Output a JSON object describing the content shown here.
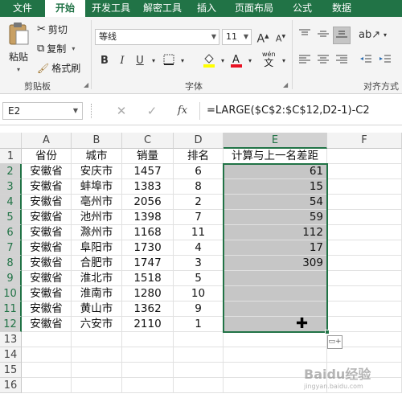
{
  "tabs": [
    {
      "label": "文件",
      "active": false
    },
    {
      "label": "开始",
      "active": true
    },
    {
      "label": "开发工具",
      "active": false
    },
    {
      "label": "解密工具",
      "active": false
    },
    {
      "label": "插入",
      "active": false
    },
    {
      "label": "页面布局",
      "active": false
    },
    {
      "label": "公式",
      "active": false
    },
    {
      "label": "数据",
      "active": false
    }
  ],
  "ribbon": {
    "clipboard": {
      "paste_label": "粘贴",
      "cut_label": "剪切",
      "copy_label": "复制",
      "format_painter_label": "格式刷",
      "group_label": "剪贴板"
    },
    "font": {
      "font_name": "等线",
      "font_size": "11",
      "group_label": "字体",
      "bold": "B",
      "italic": "I",
      "underline": "U",
      "grow": "A",
      "shrink": "A",
      "wen_label": "wén",
      "wen_char": "文",
      "fill_color": "#ffff00",
      "font_color": "#e81123"
    },
    "alignment": {
      "group_label": "对齐方式"
    }
  },
  "formula_bar": {
    "name_box": "E2",
    "fx_label": "fx",
    "formula": "=LARGE($C$2:$C$12,D2-1)-C2"
  },
  "sheet": {
    "columns": [
      "A",
      "B",
      "C",
      "D",
      "E",
      "F"
    ],
    "selected_column": "E",
    "row_numbers": [
      "1",
      "2",
      "3",
      "4",
      "5",
      "6",
      "7",
      "8",
      "9",
      "10",
      "11",
      "12",
      "13",
      "14",
      "15",
      "16"
    ],
    "header": [
      "省份",
      "城市",
      "销量",
      "排名",
      "计算与上一名差距"
    ],
    "rows": [
      {
        "province": "安徽省",
        "city": "安庆市",
        "sales": "1457",
        "rank": "6",
        "diff": "61"
      },
      {
        "province": "安徽省",
        "city": "蚌埠市",
        "sales": "1383",
        "rank": "8",
        "diff": "15"
      },
      {
        "province": "安徽省",
        "city": "亳州市",
        "sales": "2056",
        "rank": "2",
        "diff": "54"
      },
      {
        "province": "安徽省",
        "city": "池州市",
        "sales": "1398",
        "rank": "7",
        "diff": "59"
      },
      {
        "province": "安徽省",
        "city": "滁州市",
        "sales": "1168",
        "rank": "11",
        "diff": "112"
      },
      {
        "province": "安徽省",
        "city": "阜阳市",
        "sales": "1730",
        "rank": "4",
        "diff": "17"
      },
      {
        "province": "安徽省",
        "city": "合肥市",
        "sales": "1747",
        "rank": "3",
        "diff": "309"
      },
      {
        "province": "安徽省",
        "city": "淮北市",
        "sales": "1518",
        "rank": "5",
        "diff": ""
      },
      {
        "province": "安徽省",
        "city": "淮南市",
        "sales": "1280",
        "rank": "10",
        "diff": ""
      },
      {
        "province": "安徽省",
        "city": "黄山市",
        "sales": "1362",
        "rank": "9",
        "diff": ""
      },
      {
        "province": "安徽省",
        "city": "六安市",
        "sales": "2110",
        "rank": "1",
        "diff": ""
      }
    ],
    "selection_fill": "#c6c6c6",
    "accent": "#217346"
  },
  "watermark": {
    "text": "Baidu经验",
    "sub": "jingyan.baidu.com"
  }
}
